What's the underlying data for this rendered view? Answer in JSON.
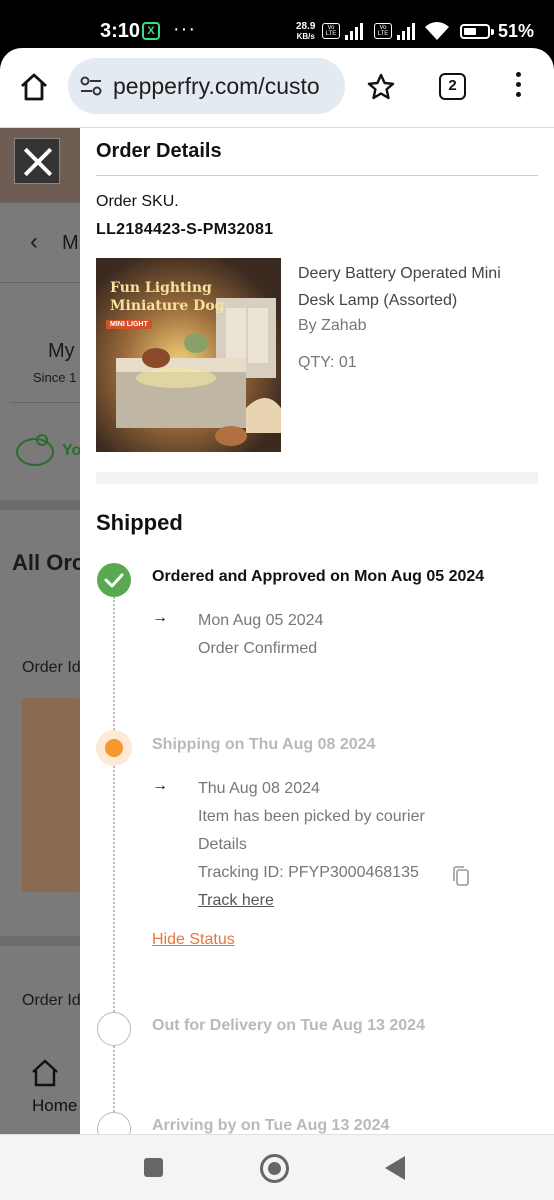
{
  "status_bar": {
    "time": "3:10",
    "app_icon": "X",
    "more": "···",
    "net_speed_value": "28.9",
    "net_speed_unit": "KB/s",
    "sim1": "Vo LTE",
    "sim2": "Vo LTE",
    "battery": "51%"
  },
  "browser": {
    "url": "pepperfry.com/custo",
    "tab_count": "2"
  },
  "background_page": {
    "back_label": "M",
    "my_label": "My",
    "since_label": "Since 1",
    "wallet_label": "Yo",
    "all_orders": "All Orc",
    "order_id_1": "Order Id",
    "order_id_2": "Order Id",
    "home_label": "Home"
  },
  "panel": {
    "title": "Order Details",
    "sku_label": "Order SKU.",
    "sku_value": "LL2184423-S-PM32081",
    "product": {
      "image_line1": "Fun Lighting",
      "image_line2": "Miniature Dog",
      "image_badge": "MINI LIGHT",
      "name": "Deery Battery Operated Mini Desk Lamp (Assorted)",
      "brand": "By Zahab",
      "qty": "QTY: 01"
    },
    "status": "Shipped",
    "timeline": {
      "step1_title": "Ordered and Approved on Mon Aug 05 2024",
      "step1_date": "Mon Aug 05 2024",
      "step1_desc": "Order Confirmed",
      "step2_title": "Shipping on Thu Aug 08 2024",
      "step2_date": "Thu Aug 08 2024",
      "step2_desc": "Item has been picked by courier",
      "step2_details": "Details",
      "step2_tracking": "Tracking ID: PFYP3000468135",
      "track_here": "Track here",
      "hide_status": "Hide Status",
      "step3_title": "Out for Delivery on Tue Aug 13 2024",
      "step4_title": "Arriving by on Tue Aug 13 2024",
      "arrow": "→"
    }
  },
  "colors": {
    "accent_orange": "#e6763a",
    "done_green": "#58a94f",
    "current_orange": "#f39a2b"
  }
}
